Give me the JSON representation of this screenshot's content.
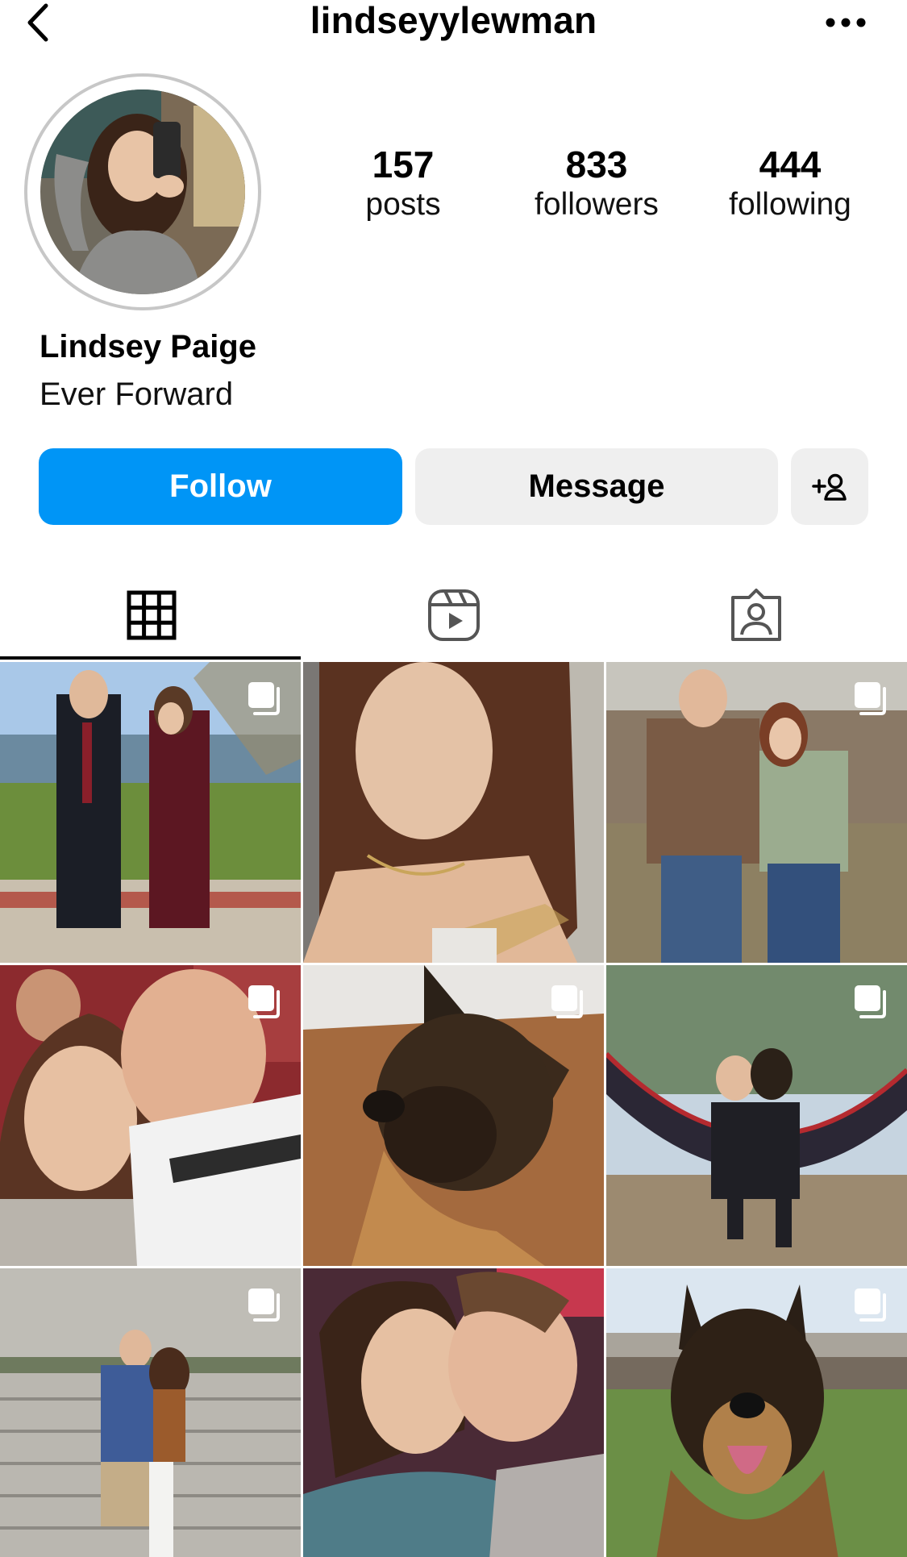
{
  "header": {
    "username": "lindseyylewman",
    "back_icon": "chevron-left-icon",
    "more_icon": "more-horizontal-icon"
  },
  "profile": {
    "display_name": "Lindsey Paige",
    "bio": "Ever Forward",
    "stats": [
      {
        "value": "157",
        "label": "posts"
      },
      {
        "value": "833",
        "label": "followers"
      },
      {
        "value": "444",
        "label": "following"
      }
    ]
  },
  "actions": {
    "follow_label": "Follow",
    "message_label": "Message",
    "add_user_icon": "add-person-icon"
  },
  "tabs": [
    {
      "name": "posts",
      "icon": "grid-icon",
      "active": true
    },
    {
      "name": "reels",
      "icon": "reels-icon",
      "active": false
    },
    {
      "name": "tagged",
      "icon": "tagged-person-icon",
      "active": false
    }
  ],
  "posts": [
    {
      "subject": "couple by lake",
      "multi": true
    },
    {
      "subject": "selfie closeup",
      "multi": false
    },
    {
      "subject": "couple by fence",
      "multi": true
    },
    {
      "subject": "couple at stadium",
      "multi": true
    },
    {
      "subject": "german shepherd puppy on couch",
      "multi": true
    },
    {
      "subject": "friends in hammock",
      "multi": true
    },
    {
      "subject": "couple on steps",
      "multi": true
    },
    {
      "subject": "couple kiss",
      "multi": false
    },
    {
      "subject": "german shepherd on grass",
      "multi": true
    }
  ],
  "colors": {
    "follow_blue": "#0095f6",
    "button_gray": "#efefef",
    "ring_gray": "#c7c7c7"
  }
}
